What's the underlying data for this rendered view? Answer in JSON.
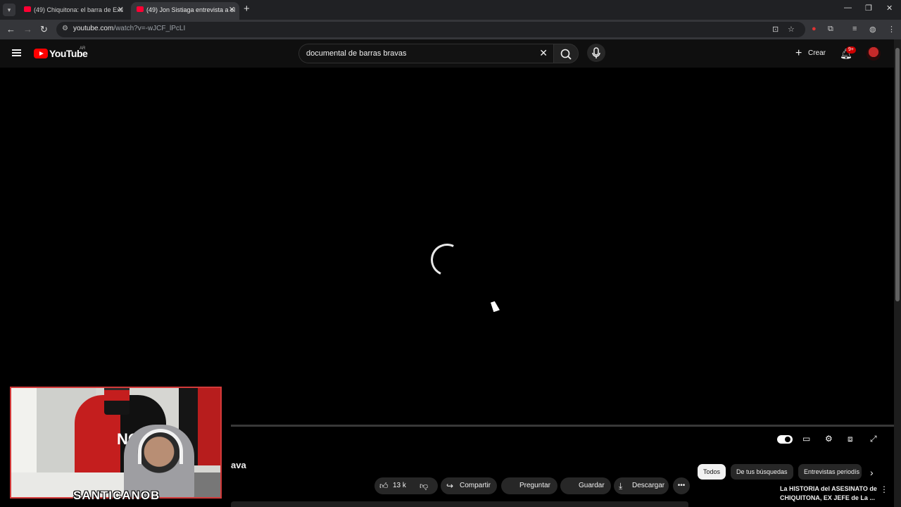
{
  "browser": {
    "tabs": [
      {
        "title": "(49) Chiquitona: el barra de Exc",
        "active": false
      },
      {
        "title": "(49) Jon Sistiaga entrevista a el",
        "active": true
      }
    ],
    "url_host": "youtube.com",
    "url_path": "/watch?v=-wJCF_lPcLI"
  },
  "youtube": {
    "logo_text": "YouTube",
    "country_code": "AR",
    "search_query": "documental de barras bravas",
    "create_label": "Crear",
    "notification_badge": "9+"
  },
  "video": {
    "title_fragment": "ava",
    "like_count": "13 k",
    "actions": {
      "share": "Compartir",
      "ask": "Preguntar",
      "save": "Guardar",
      "download": "Descargar"
    }
  },
  "chips": [
    "Todos",
    "De tus búsquedas",
    "Entrevistas periodís"
  ],
  "recommendation": {
    "title": "La HISTORIA del ASESINATO de CHIQUITONA, EX JEFE de La ..."
  },
  "overlay": {
    "streamer_name": "SANTICANOB",
    "flag_text": "NO"
  }
}
